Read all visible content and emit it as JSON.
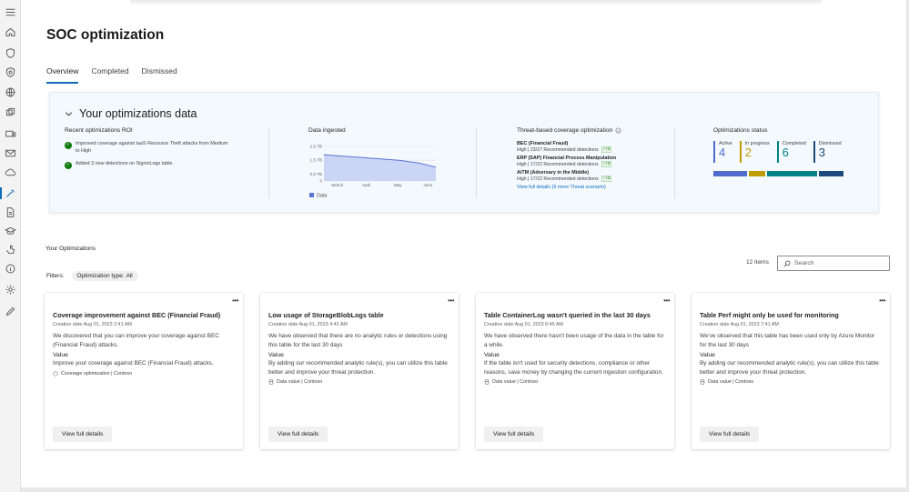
{
  "page": {
    "title": "SOC optimization",
    "tabs": [
      {
        "label": "Overview",
        "active": true
      },
      {
        "label": "Completed",
        "active": false
      },
      {
        "label": "Dismissed",
        "active": false
      }
    ]
  },
  "panel": {
    "title": "Your optimizations data",
    "roi": {
      "title": "Recent optimizations ROI",
      "items": [
        "Improved coverage against IaaS Resource Theft attacks from Medium to High",
        "Added 3 new detections on SigninLogs table."
      ]
    },
    "ingested": {
      "title": "Data ingested",
      "legend": "Data"
    },
    "threat": {
      "title": "Threat-based coverage optimization",
      "items": [
        {
          "name": "BEC (Financial Fraud)",
          "meta": "High | 23/27 Recommended detections",
          "delta": "+3"
        },
        {
          "name": "ERP (SAP) Financial Process Manipulation",
          "meta": "High | 17/22 Recommended detections",
          "delta": "+3"
        },
        {
          "name": "AiTM (Adversary in the Middle)",
          "meta": "High | 17/22 Recommended detections",
          "delta": "+3"
        }
      ],
      "link": "View full details (5 more Threat scenario)"
    },
    "status": {
      "title": "Optimizations status",
      "items": [
        {
          "label": "Active",
          "value": "4",
          "color": "#4f6bcc"
        },
        {
          "label": "In progress",
          "value": "2",
          "color": "#c19c00"
        },
        {
          "label": "Completed",
          "value": "6",
          "color": "#038387"
        },
        {
          "label": "Dismissed",
          "value": "3",
          "color": "#1d4a7e"
        }
      ]
    }
  },
  "chart_data": {
    "type": "area",
    "title": "Data ingested",
    "categories": [
      "March",
      "April",
      "May",
      "June"
    ],
    "series": [
      {
        "name": "Data",
        "values": [
          1.9,
          1.7,
          1.5,
          1.3,
          1.0
        ]
      }
    ],
    "x_positions": [
      0,
      0.33,
      0.67,
      0.85,
      1.0
    ],
    "ylim": [
      0,
      2.5
    ],
    "yticks": [
      "2.5 TB",
      "1.5 TB",
      "0.5 TB",
      "0"
    ],
    "grid": true,
    "legend": "bottom-left"
  },
  "optimizations": {
    "title": "Your Optimizations",
    "filters_label": "Filters:",
    "filter_pill": {
      "label": "Optimization type:",
      "value": "All"
    },
    "count": "12 items",
    "search_placeholder": "Search",
    "cards": [
      {
        "title": "Coverage improvement against BEC (Financial Fraud)",
        "date": "Creation date Aug 01, 2023 2:41 AM",
        "desc": "We discovered that you can improve your coverage against BEC (Financial Fraud) attacks.",
        "value_label": "Value",
        "value": "Improve your coverage against BEC (Financial Fraud) attacks.",
        "tag": "Coverage optimization | Contoso",
        "button": "View full details"
      },
      {
        "title": "Low usage of StorageBlobLogs table",
        "date": "Creation date Aug 01, 2023 4:42 AM",
        "desc": "We have observed that there are no analytic rules or detections using this table for the last 30 days",
        "value_label": "Value",
        "value": "By adding our recommended analytic rule(s), you can utilize this table better and improve your threat protection.",
        "tag": "Data value | Contoso",
        "button": "View full details"
      },
      {
        "title": "Table ContainerLog wasn't queried in the last 30 days",
        "date": "Creation date Aug 01, 2023 6:45 AM",
        "desc": "We have observed there hasn't been usage of the data in the table for a while.",
        "value_label": "Value",
        "value": "If the table isn't used for security detections, compliance or other reasons, save money by changing the current ingestion configuration.",
        "tag": "Data value | Contoso",
        "button": "View full details"
      },
      {
        "title": "Table Perf might only be used for monitoring",
        "date": "Creation date Aug 01, 2023 7:41 AM",
        "desc": "We've observed that this table has been used only by Azure Monitor for the last 30 days",
        "value_label": "Value",
        "value": "By adding our recommended analytic rule(s), you can utilize this table better and improve your threat protection.",
        "tag": "Data value | Contoso",
        "button": "View full details"
      }
    ]
  },
  "rail": {
    "icons": [
      "menu-icon",
      "home-icon",
      "shield-icon",
      "shield-gear-icon",
      "globe-icon",
      "layers-icon",
      "devices-icon",
      "mail-icon",
      "cloud-icon",
      "wand-icon",
      "document-icon",
      "learn-icon",
      "hand-icon",
      "info-icon",
      "settings-icon",
      "edit-icon"
    ],
    "active": "wand-icon"
  }
}
